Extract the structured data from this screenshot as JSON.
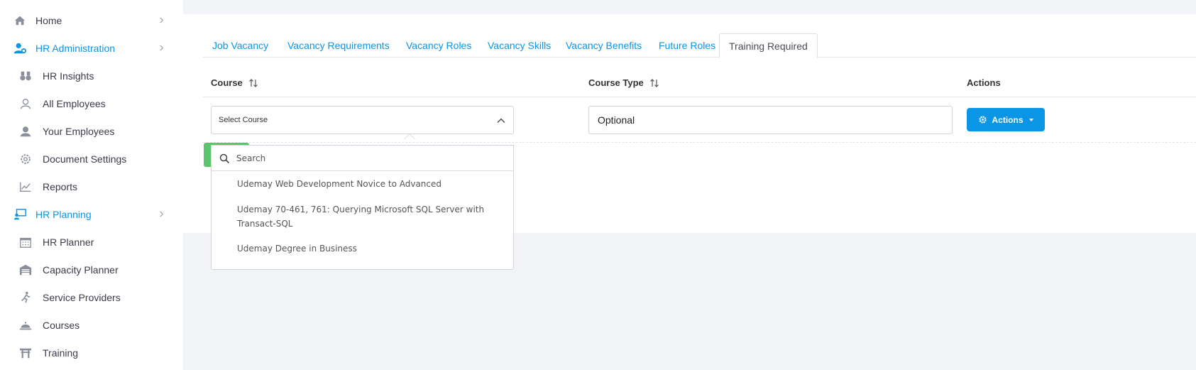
{
  "sidebar": {
    "items": [
      {
        "label": "Home",
        "icon": "home-icon",
        "level": "top",
        "chevron": true,
        "active": false
      },
      {
        "label": "HR Administration",
        "icon": "user-gear-icon",
        "level": "top",
        "chevron": true,
        "active": true
      },
      {
        "label": "HR Insights",
        "icon": "binoculars-icon",
        "level": "sub"
      },
      {
        "label": "All Employees",
        "icon": "user-outline-icon",
        "level": "sub"
      },
      {
        "label": "Your Employees",
        "icon": "user-solid-icon",
        "level": "sub"
      },
      {
        "label": "Document Settings",
        "icon": "gear-icon",
        "level": "sub"
      },
      {
        "label": "Reports",
        "icon": "chart-line-icon",
        "level": "sub"
      },
      {
        "label": "HR Planning",
        "icon": "presentation-user-icon",
        "level": "top",
        "chevron": true,
        "active": true
      },
      {
        "label": "HR Planner",
        "icon": "calendar-icon",
        "level": "sub"
      },
      {
        "label": "Capacity Planner",
        "icon": "warehouse-icon",
        "level": "sub"
      },
      {
        "label": "Service Providers",
        "icon": "runner-icon",
        "level": "sub"
      },
      {
        "label": "Courses",
        "icon": "cloche-icon",
        "level": "sub"
      },
      {
        "label": "Training",
        "icon": "torii-icon",
        "level": "sub"
      }
    ]
  },
  "tabs": [
    {
      "label": "Job Vacancy",
      "active": false
    },
    {
      "label": "Vacancy Requirements",
      "active": false
    },
    {
      "label": "Vacancy Roles",
      "active": false
    },
    {
      "label": "Vacancy Skills",
      "active": false
    },
    {
      "label": "Vacancy Benefits",
      "active": false
    },
    {
      "label": "Future Roles",
      "active": false
    },
    {
      "label": "Training Required",
      "active": true
    }
  ],
  "table": {
    "headers": {
      "course": "Course",
      "course_type": "Course Type",
      "actions": "Actions"
    },
    "row": {
      "course_select_value": "Select Course",
      "course_type_value": "Optional",
      "actions_button": "Actions"
    }
  },
  "dropdown": {
    "search_placeholder": "Search",
    "search_value": "",
    "options": [
      "Udemay Web Development Novice to Advanced",
      "Udemay 70-461, 761: Querying Microsoft SQL Server with Transact-SQL",
      "Udemay Degree in Business"
    ]
  },
  "colors": {
    "accent": "#0a95e6",
    "green": "#5cc46c",
    "background": "#f3f4f8"
  }
}
